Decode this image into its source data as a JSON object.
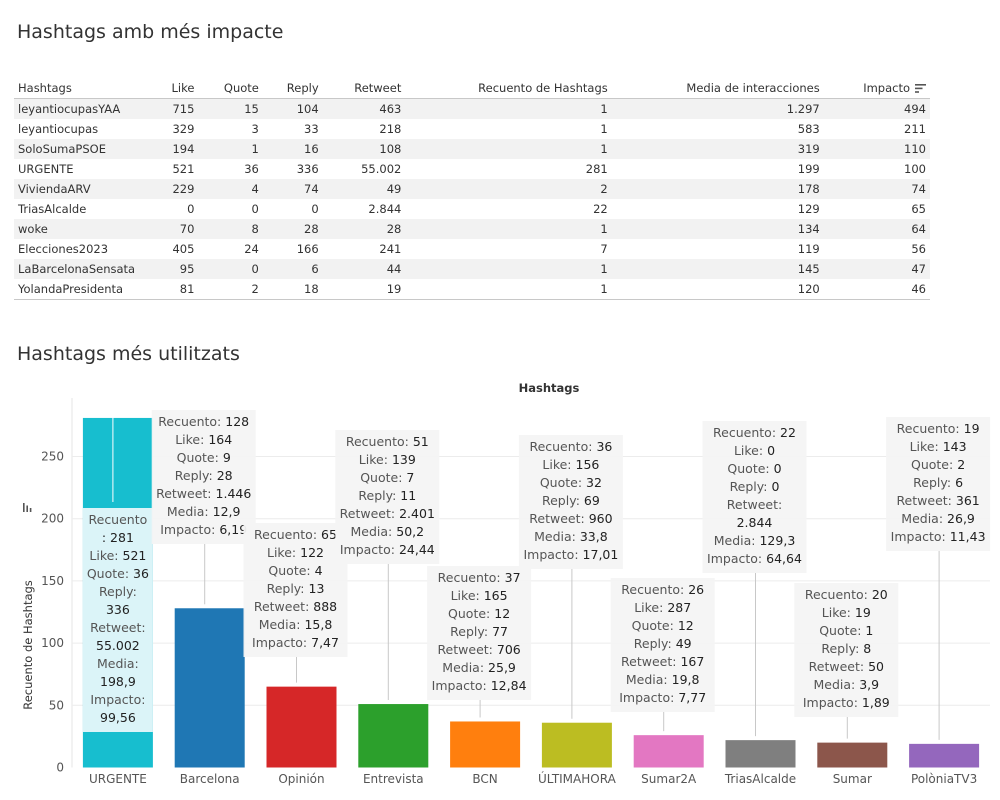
{
  "table_section": {
    "title": "Hashtags amb més impacte",
    "columns": [
      "Hashtags",
      "Like",
      "Quote",
      "Reply",
      "Retweet",
      "Recuento de Hashtags",
      "Media de interacciones",
      "Impacto"
    ],
    "sort_icon": "sort-descending-icon",
    "rows": [
      [
        "leyantiocupasYAA",
        "715",
        "15",
        "104",
        "463",
        "1",
        "1.297",
        "494"
      ],
      [
        "leyantiocupas",
        "329",
        "3",
        "33",
        "218",
        "1",
        "583",
        "211"
      ],
      [
        "SoloSumaPSOE",
        "194",
        "1",
        "16",
        "108",
        "1",
        "319",
        "110"
      ],
      [
        "URGENTE",
        "521",
        "36",
        "336",
        "55.002",
        "281",
        "199",
        "100"
      ],
      [
        "ViviendaARV",
        "229",
        "4",
        "74",
        "49",
        "2",
        "178",
        "74"
      ],
      [
        "TriasAlcalde",
        "0",
        "0",
        "0",
        "2.844",
        "22",
        "129",
        "65"
      ],
      [
        "woke",
        "70",
        "8",
        "28",
        "28",
        "1",
        "134",
        "64"
      ],
      [
        "Elecciones2023",
        "405",
        "24",
        "166",
        "241",
        "7",
        "119",
        "56"
      ],
      [
        "LaBarcelonaSensata",
        "95",
        "0",
        "6",
        "44",
        "1",
        "145",
        "47"
      ],
      [
        "YolandaPresidenta",
        "81",
        "2",
        "18",
        "19",
        "1",
        "120",
        "46"
      ]
    ]
  },
  "chart_section": {
    "title": "Hashtags més utilitzats"
  },
  "chart_data": {
    "type": "bar",
    "title": "Hashtags",
    "xlabel": "Hashtags",
    "ylabel": "Recuento de Hashtags",
    "ylim": [
      0,
      290
    ],
    "yticks": [
      0,
      50,
      100,
      150,
      200,
      250
    ],
    "grid": true,
    "sort_icon": "sort-descending-icon",
    "tooltip_labels": [
      "Recuento:",
      "Like:",
      "Quote:",
      "Reply:",
      "Retweet:",
      "Media:",
      "Impacto:"
    ],
    "categories": [
      "URGENTE",
      "Barcelona",
      "Opinión",
      "Entrevista",
      "BCN",
      "ÚLTIMAHORA",
      "Sumar2A",
      "TriasAlcalde",
      "Sumar",
      "PolòniaTV3"
    ],
    "values": [
      281,
      128,
      65,
      51,
      37,
      36,
      26,
      22,
      20,
      19
    ],
    "colors": [
      "#17becf",
      "#1f77b4",
      "#d62728",
      "#2ca02c",
      "#ff7f0e",
      "#bcbd22",
      "#e377c2",
      "#7f7f7f",
      "#8c564b",
      "#9467bd"
    ],
    "details": [
      {
        "recuento": "281",
        "like": "521",
        "quote": "36",
        "reply": "336",
        "retweet": "55.002",
        "media": "198,9",
        "impacto": "99,56"
      },
      {
        "recuento": "128",
        "like": "164",
        "quote": "9",
        "reply": "28",
        "retweet": "1.446",
        "media": "12,9",
        "impacto": "6,19"
      },
      {
        "recuento": "65",
        "like": "122",
        "quote": "4",
        "reply": "13",
        "retweet": "888",
        "media": "15,8",
        "impacto": "7,47"
      },
      {
        "recuento": "51",
        "like": "139",
        "quote": "7",
        "reply": "11",
        "retweet": "2.401",
        "media": "50,2",
        "impacto": "24,44"
      },
      {
        "recuento": "37",
        "like": "165",
        "quote": "12",
        "reply": "77",
        "retweet": "706",
        "media": "25,9",
        "impacto": "12,84"
      },
      {
        "recuento": "36",
        "like": "156",
        "quote": "32",
        "reply": "69",
        "retweet": "960",
        "media": "33,8",
        "impacto": "17,01"
      },
      {
        "recuento": "26",
        "like": "287",
        "quote": "12",
        "reply": "49",
        "retweet": "167",
        "media": "19,8",
        "impacto": "7,77"
      },
      {
        "recuento": "22",
        "like": "0",
        "quote": "0",
        "reply": "0",
        "retweet": "2.844",
        "media": "129,3",
        "impacto": "64,64"
      },
      {
        "recuento": "20",
        "like": "19",
        "quote": "1",
        "reply": "8",
        "retweet": "50",
        "media": "3,9",
        "impacto": "1,89"
      },
      {
        "recuento": "19",
        "like": "143",
        "quote": "2",
        "reply": "6",
        "retweet": "361",
        "media": "26,9",
        "impacto": "11,43"
      }
    ]
  }
}
